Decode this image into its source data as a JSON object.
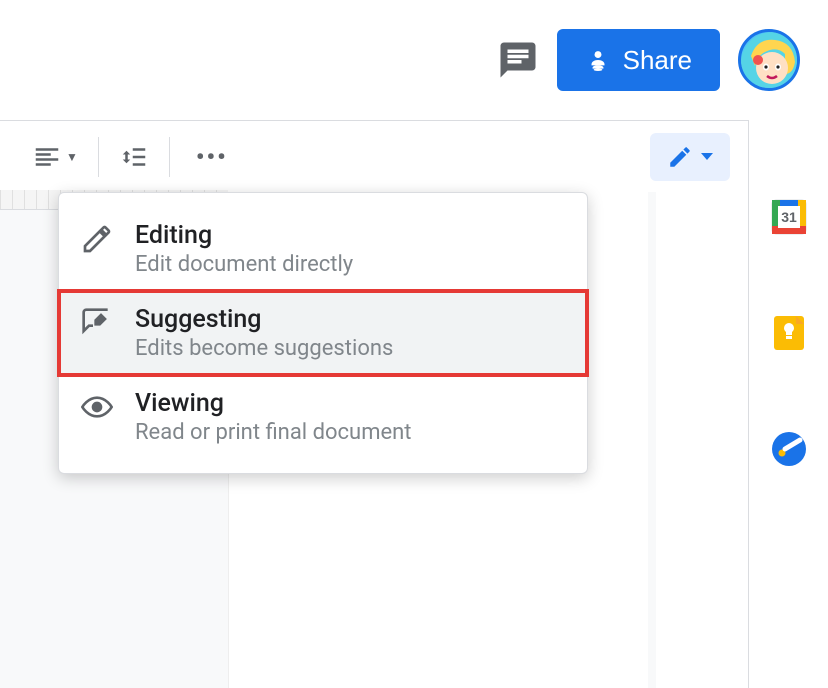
{
  "topbar": {
    "share_label": "Share"
  },
  "mode_menu": {
    "items": [
      {
        "title": "Editing",
        "desc": "Edit document directly"
      },
      {
        "title": "Suggesting",
        "desc": "Edits become suggestions"
      },
      {
        "title": "Viewing",
        "desc": "Read or print final document"
      }
    ],
    "highlighted_index": 1
  },
  "side_apps": {
    "calendar_day": "31"
  },
  "colors": {
    "primary": "#1a73e8",
    "highlight_outline": "#e53935"
  }
}
